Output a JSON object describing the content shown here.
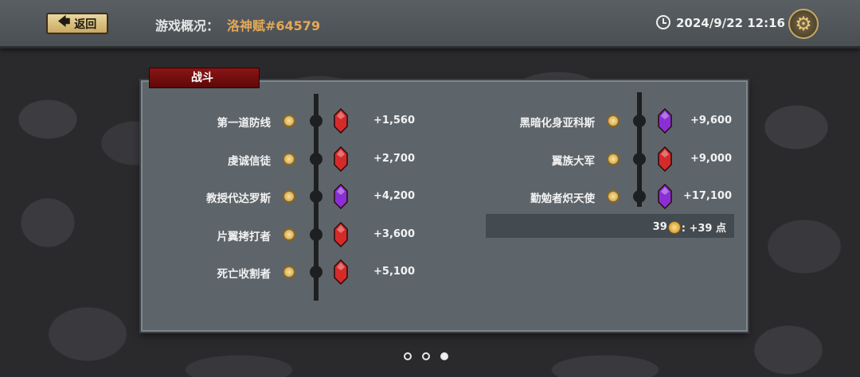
{
  "header": {
    "back_label": "返回",
    "title_label": "游戏概况：",
    "title_value": "洛神赋#64579",
    "datetime": "2024/9/22 12:16"
  },
  "panel": {
    "tab_label": "战斗",
    "left_bosses": [
      {
        "name": "第一道防线",
        "points": "+1,560",
        "gem": "red"
      },
      {
        "name": "虔诚信徒",
        "points": "+2,700",
        "gem": "red"
      },
      {
        "name": "教授代达罗斯",
        "points": "+4,200",
        "gem": "purple"
      },
      {
        "name": "片翼拷打者",
        "points": "+3,600",
        "gem": "red"
      },
      {
        "name": "死亡收割者",
        "points": "+5,100",
        "gem": "red"
      }
    ],
    "right_bosses": [
      {
        "name": "黑暗化身亚科斯",
        "points": "+9,600",
        "gem": "purple"
      },
      {
        "name": "翼族大军",
        "points": "+9,000",
        "gem": "red"
      },
      {
        "name": "勤勉者炽天使",
        "points": "+17,100",
        "gem": "purple"
      }
    ],
    "summary": {
      "count": "39",
      "text": ": +39 点"
    }
  },
  "pagination": {
    "total": 3,
    "active": 3
  },
  "colors": {
    "red_gem": "#d42a2a",
    "purple_gem": "#8a2fd6",
    "title_accent": "#e2a858"
  }
}
